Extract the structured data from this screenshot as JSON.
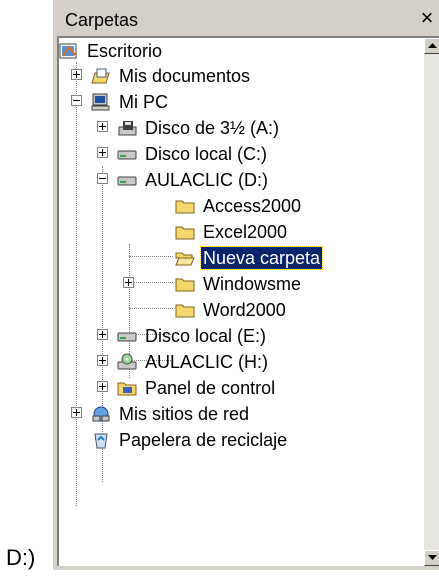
{
  "stray_text": "D:)",
  "panel": {
    "title": "Carpetas",
    "close_glyph": "×"
  },
  "tree": [
    {
      "label": "Escritorio",
      "icon": "desktop-icon"
    },
    {
      "label": "Mis documentos",
      "icon": "my-documents-icon"
    },
    {
      "label": "Mi PC",
      "icon": "my-computer-icon"
    },
    {
      "label": "Disco de 3½ (A:)",
      "icon": "floppy-drive-icon"
    },
    {
      "label": "Disco local (C:)",
      "icon": "hard-drive-icon"
    },
    {
      "label": "AULACLIC (D:)",
      "icon": "hard-drive-icon"
    },
    {
      "label": "Access2000",
      "icon": "folder-icon"
    },
    {
      "label": "Excel2000",
      "icon": "folder-icon"
    },
    {
      "label": "Nueva carpeta",
      "icon": "open-folder-icon",
      "selected": true
    },
    {
      "label": "Windowsme",
      "icon": "folder-icon"
    },
    {
      "label": "Word2000",
      "icon": "folder-icon"
    },
    {
      "label": "Disco local (E:)",
      "icon": "hard-drive-icon"
    },
    {
      "label": "AULACLIC (H:)",
      "icon": "cd-drive-icon"
    },
    {
      "label": "Panel de control",
      "icon": "control-panel-icon"
    },
    {
      "label": "Mis sitios de red",
      "icon": "network-places-icon"
    },
    {
      "label": "Papelera de reciclaje",
      "icon": "recycle-bin-icon"
    }
  ],
  "colors": {
    "selection": "#0a246a",
    "panel_face": "#d4d0c8",
    "folder": "#f4d86c"
  }
}
